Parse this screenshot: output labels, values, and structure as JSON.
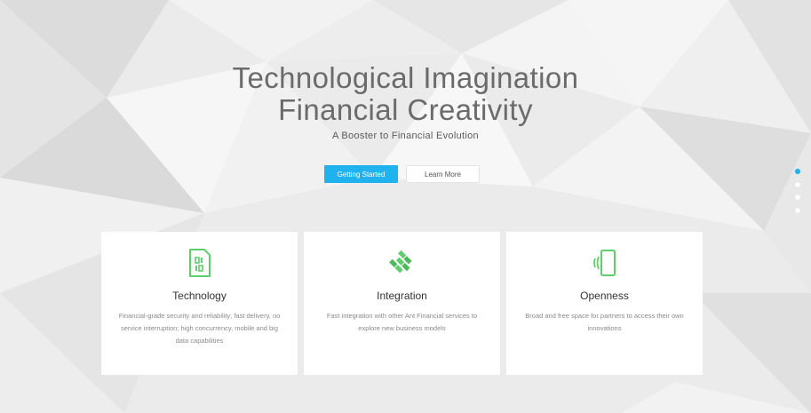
{
  "hero": {
    "title_line1": "Technological Imagination",
    "title_line2": "Financial Creativity",
    "subtitle": "A Booster to Financial Evolution",
    "primary_button": "Getting Started",
    "secondary_button": "Learn More"
  },
  "carousel": {
    "slides": 4,
    "active": 1
  },
  "colors": {
    "accent": "#1fb2ef",
    "icon_green": "#5fce6d"
  },
  "features": [
    {
      "icon": "sim-card-icon",
      "title": "Technology",
      "description": "Financial-grade security and reliability; fast delivery, no service interruption; high concurrency, mobile and big data capabilities"
    },
    {
      "icon": "interlocking-hands-icon",
      "title": "Integration",
      "description": "Fast integration with other Ant Financial services to explore new business models"
    },
    {
      "icon": "mobile-signal-icon",
      "title": "Openness",
      "description": "Broad and free space for partners to access their own innovations"
    }
  ]
}
